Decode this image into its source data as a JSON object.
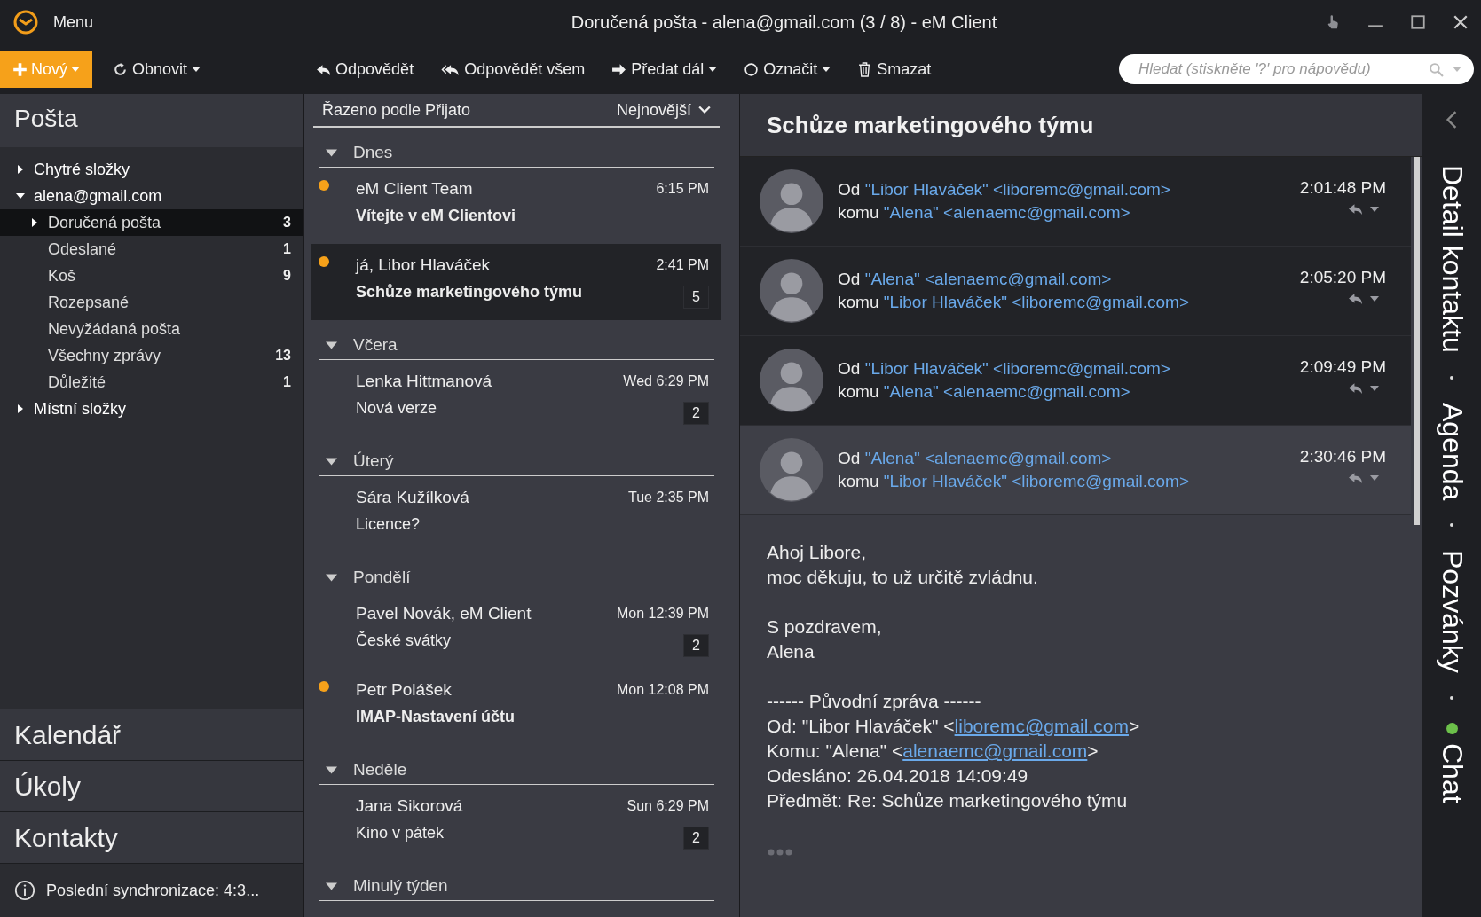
{
  "window": {
    "title": "Doručená pošta - alena@gmail.com (3 / 8) - eM Client",
    "menu_label": "Menu"
  },
  "toolbar": {
    "new_label": "Nový",
    "items": [
      {
        "label": "Obnovit",
        "kind": "refresh",
        "dropdown": true
      },
      {
        "label": "Odpovědět",
        "kind": "reply",
        "dropdown": false
      },
      {
        "label": "Odpovědět všem",
        "kind": "reply-all",
        "dropdown": false
      },
      {
        "label": "Předat dál",
        "kind": "forward",
        "dropdown": true
      },
      {
        "label": "Označit",
        "kind": "mark",
        "dropdown": true
      },
      {
        "label": "Smazat",
        "kind": "delete",
        "dropdown": false
      }
    ],
    "search": {
      "placeholder": "Hledat (stiskněte '?' pro nápovědu)"
    }
  },
  "sidebar": {
    "title": "Pošta",
    "folders": [
      {
        "name": "Chytré složky",
        "expanded": false,
        "selected": false
      },
      {
        "name": "alena@gmail.com",
        "expanded": true,
        "selected": false,
        "children": [
          {
            "name": "Doručená pošta",
            "count": "3",
            "expanded": false,
            "selected": true
          },
          {
            "name": "Odeslané",
            "count": "1",
            "selected": false
          },
          {
            "name": "Koš",
            "count": "9",
            "selected": false
          },
          {
            "name": "Rozepsané",
            "selected": false
          },
          {
            "name": "Nevyžádaná pošta",
            "selected": false
          },
          {
            "name": "Všechny zprávy",
            "count": "13",
            "selected": false
          },
          {
            "name": "Důležité",
            "count": "1",
            "selected": false
          }
        ]
      },
      {
        "name": "Místní složky",
        "expanded": false,
        "selected": false
      }
    ],
    "nav": [
      "Kalendář",
      "Úkoly",
      "Kontakty"
    ],
    "status": "Poslední synchronizace: 4:3..."
  },
  "list": {
    "sort_label": "Řazeno podle Přijato",
    "order_label": "Nejnovější",
    "groups": [
      {
        "name": "Dnes",
        "messages": [
          {
            "sender": "eM Client Team",
            "subject": "Vítejte v eM Clientovi",
            "time": "6:15 PM",
            "unread": true,
            "selected": false
          },
          {
            "sender": "já, Libor Hlaváček",
            "subject": "Schůze marketingového týmu",
            "time": "2:41 PM",
            "count": "5",
            "unread": true,
            "selected": true
          }
        ]
      },
      {
        "name": "Včera",
        "messages": [
          {
            "sender": "Lenka Hittmanová",
            "subject": "Nová verze",
            "time": "Wed 6:29 PM",
            "count": "2",
            "unread": false,
            "selected": false
          }
        ]
      },
      {
        "name": "Úterý",
        "messages": [
          {
            "sender": "Sára Kužílková",
            "subject": "Licence?",
            "time": "Tue 2:35 PM",
            "unread": false,
            "selected": false
          }
        ]
      },
      {
        "name": "Pondělí",
        "messages": [
          {
            "sender": "Pavel Novák, eM Client",
            "subject": "České svátky",
            "time": "Mon 12:39 PM",
            "count": "2",
            "unread": false,
            "selected": false
          },
          {
            "sender": "Petr Polášek",
            "subject": "IMAP-Nastavení účtu",
            "time": "Mon 12:08 PM",
            "unread": true,
            "selected": false
          }
        ]
      },
      {
        "name": "Neděle",
        "messages": [
          {
            "sender": "Jana Sikorová",
            "subject": "Kino v pátek",
            "time": "Sun 6:29 PM",
            "count": "2",
            "unread": false,
            "selected": false
          }
        ]
      },
      {
        "name": "Minulý týden"
      }
    ]
  },
  "reader": {
    "subject": "Schůze marketingového týmu",
    "thread": [
      {
        "from_label": "Od",
        "from": "\"Libor Hlaváček\" <liboremc@gmail.com>",
        "to_label": "komu",
        "to": "\"Alena\" <alenaemc@gmail.com>",
        "time": "2:01:48 PM",
        "selected": false
      },
      {
        "from_label": "Od",
        "from": "\"Alena\" <alenaemc@gmail.com>",
        "to_label": "komu",
        "to": "\"Libor Hlaváček\" <liboremc@gmail.com>",
        "time": "2:05:20 PM",
        "selected": false
      },
      {
        "from_label": "Od",
        "from": "\"Libor Hlaváček\" <liboremc@gmail.com>",
        "to_label": "komu",
        "to": "\"Alena\" <alenaemc@gmail.com>",
        "time": "2:09:49 PM",
        "selected": false
      },
      {
        "from_label": "Od",
        "from": "\"Alena\" <alenaemc@gmail.com>",
        "to_label": "komu",
        "to": "\"Libor Hlaváček\" <liboremc@gmail.com>",
        "time": "2:30:46 PM",
        "selected": true
      }
    ],
    "body": [
      {
        "lines": [
          "Ahoj Libore,",
          "moc děkuju, to už určitě zvládnu."
        ]
      },
      {
        "lines": [
          "S pozdravem,",
          "Alena"
        ]
      },
      {
        "lines": [
          "------ Původní zpráva ------"
        ],
        "quote": [
          {
            "before": "Od: \"Libor Hlaváček\" <",
            "link": "liboremc@gmail.com",
            "after": ">"
          },
          {
            "before": "Komu: \"Alena\" <",
            "link": "alenaemc@gmail.com",
            "after": ">"
          },
          {
            "before": "Odesláno: 26.04.2018 14:09:49"
          },
          {
            "before": "Předmět: Re: Schůze marketingového týmu"
          }
        ]
      }
    ]
  },
  "side_tabs": [
    {
      "label": "Detail kontaktu"
    },
    {
      "label": "Agenda"
    },
    {
      "label": "Pozvánky"
    },
    {
      "label": "Chat",
      "color": "#6cc04a"
    }
  ]
}
